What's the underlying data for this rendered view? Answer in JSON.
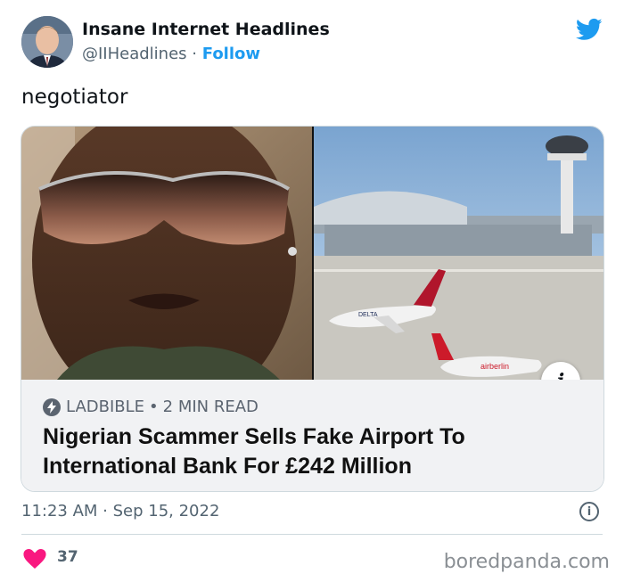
{
  "author": {
    "name": "Insane Internet Headlines",
    "handle": "@IIHeadlines",
    "separator": "·",
    "follow_label": "Follow"
  },
  "icons": {
    "platform": "twitter-bird-icon",
    "info": "info-icon",
    "like": "heart-icon",
    "source": "lightning-bolt-icon"
  },
  "colors": {
    "twitter_blue": "#1d9bf0",
    "like_pink": "#f91880",
    "card_meta_bg": "#f1f2f4"
  },
  "tweet": {
    "text": "negotiator",
    "timestamp": "11:23 AM · Sep 15, 2022"
  },
  "card": {
    "source": "LADBIBLE",
    "separator": "•",
    "read_time": "2 MIN READ",
    "headline": "Nigerian Scammer Sells Fake Airport To International Bank For £242 Million",
    "info_glyph": "i",
    "airplane_livery_1": "DELTA",
    "airplane_livery_2": "airberlin"
  },
  "stats": {
    "likes": "37"
  },
  "watermark": "boredpanda.com"
}
